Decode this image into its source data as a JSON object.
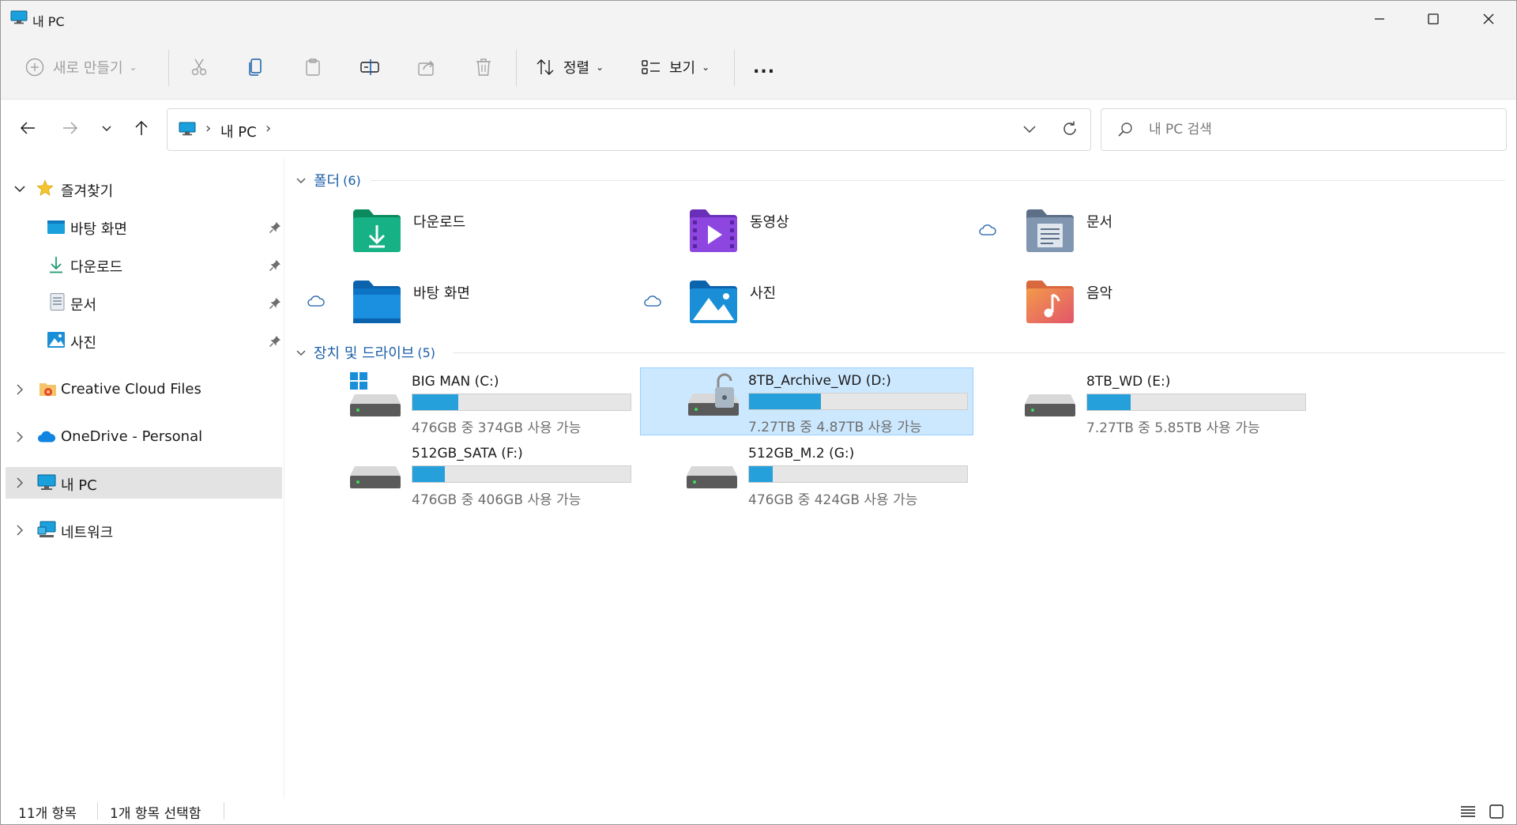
{
  "window": {
    "title": "내 PC"
  },
  "toolbar": {
    "new_label": "새로 만들기",
    "sort_label": "정렬",
    "view_label": "보기",
    "more_label": "..."
  },
  "address": {
    "path_label": "내 PC",
    "sep1": "›",
    "sep2": "›"
  },
  "search": {
    "placeholder": "내 PC 검색"
  },
  "sidebar": {
    "favorites": "즐겨찾기",
    "pinned": [
      {
        "label": "바탕 화면"
      },
      {
        "label": "다운로드"
      },
      {
        "label": "문서"
      },
      {
        "label": "사진"
      }
    ],
    "creative_cloud": "Creative Cloud Files",
    "onedrive": "OneDrive - Personal",
    "this_pc": "내 PC",
    "network": "네트워크"
  },
  "folders_section": {
    "label": "폴더",
    "count": "(6)",
    "items": [
      {
        "name": "다운로드",
        "icon": "downloads-folder-icon"
      },
      {
        "name": "동영상",
        "icon": "videos-folder-icon"
      },
      {
        "name": "문서",
        "icon": "documents-folder-icon"
      },
      {
        "name": "바탕 화면",
        "icon": "desktop-folder-icon"
      },
      {
        "name": "사진",
        "icon": "pictures-folder-icon"
      },
      {
        "name": "음악",
        "icon": "music-folder-icon"
      }
    ]
  },
  "drives_section": {
    "label": "장치 및 드라이브",
    "count": "(5)",
    "items": [
      {
        "name": "BIG MAN (C:)",
        "free_text": "476GB 중 374GB 사용 가능",
        "used_fraction": 0.21
      },
      {
        "name": "8TB_Archive_WD (D:)",
        "free_text": "7.27TB 중 4.87TB 사용 가능",
        "used_fraction": 0.33
      },
      {
        "name": "8TB_WD (E:)",
        "free_text": "7.27TB 중 5.85TB 사용 가능",
        "used_fraction": 0.2
      },
      {
        "name": "512GB_SATA (F:)",
        "free_text": "476GB 중 406GB 사용 가능",
        "used_fraction": 0.15
      },
      {
        "name": "512GB_M.2 (G:)",
        "free_text": "476GB 중 424GB 사용 가능",
        "used_fraction": 0.11
      }
    ]
  },
  "status": {
    "item_count": "11개 항목",
    "selected_count": "1개 항목 선택함"
  },
  "colors": {
    "accent": "#26a0da",
    "section_header": "#1b5ea8",
    "selection_bg": "#cce8ff",
    "chrome_bg": "#f3f3f3"
  }
}
